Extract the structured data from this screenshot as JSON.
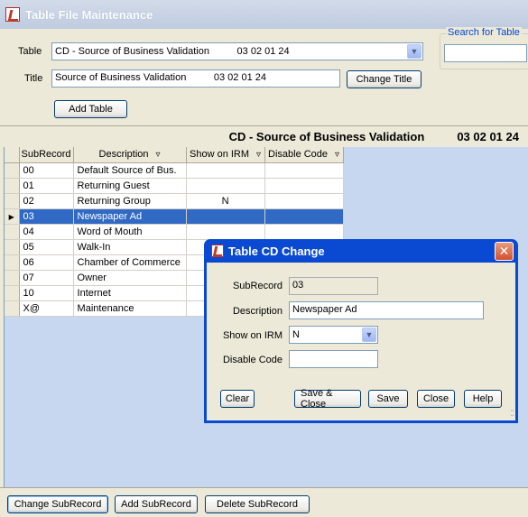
{
  "window": {
    "title": "Table File Maintenance"
  },
  "table_field": {
    "label": "Table",
    "value": "CD - Source of Business Validation          03 02 01 24"
  },
  "title_field": {
    "label": "Title",
    "value": "Source of Business Validation          03 02 01 24"
  },
  "buttons": {
    "change_title": "Change Title",
    "add_table": "Add Table"
  },
  "search": {
    "label": "Search for Table",
    "value": ""
  },
  "banner": {
    "title": "CD - Source of Business Validation",
    "code": "03 02 01 24"
  },
  "grid": {
    "columns": [
      "SubRecord",
      "Description",
      "Show on IRM",
      "Disable Code"
    ],
    "rows": [
      [
        "00",
        "Default Source of Bus.",
        "",
        ""
      ],
      [
        "01",
        "Returning Guest",
        "",
        ""
      ],
      [
        "02",
        "Returning Group",
        "N",
        ""
      ],
      [
        "03",
        "Newspaper Ad",
        "",
        ""
      ],
      [
        "04",
        "Word of Mouth",
        "",
        ""
      ],
      [
        "05",
        "Walk-In",
        "",
        ""
      ],
      [
        "06",
        "Chamber of Commerce",
        "",
        ""
      ],
      [
        "07",
        "Owner",
        "",
        ""
      ],
      [
        "10",
        "Internet",
        "",
        ""
      ],
      [
        "X@",
        "Maintenance",
        "",
        ""
      ]
    ],
    "selected_index": 3
  },
  "bottom_buttons": {
    "change": "Change SubRecord",
    "add": "Add SubRecord",
    "delete": "Delete SubRecord"
  },
  "dialog": {
    "title": "Table CD Change",
    "subrecord_label": "SubRecord",
    "subrecord_value": "03",
    "description_label": "Description",
    "description_value": "Newspaper Ad",
    "show_irm_label": "Show on IRM",
    "show_irm_value": "N",
    "disable_label": "Disable Code",
    "disable_value": "",
    "buttons": {
      "clear": "Clear",
      "save_close": "Save & Close",
      "save": "Save",
      "close": "Close",
      "help": "Help"
    }
  },
  "icons": {
    "app": "app-logo-icon",
    "dropdown": "chevron-down-icon",
    "filter": "filter-icon",
    "close": "close-icon",
    "row_pointer": "row-pointer-icon"
  },
  "colors": {
    "selection": "#316ac5",
    "dialog_frame": "#0a49d2",
    "title_bar": "#c6d2e6"
  }
}
